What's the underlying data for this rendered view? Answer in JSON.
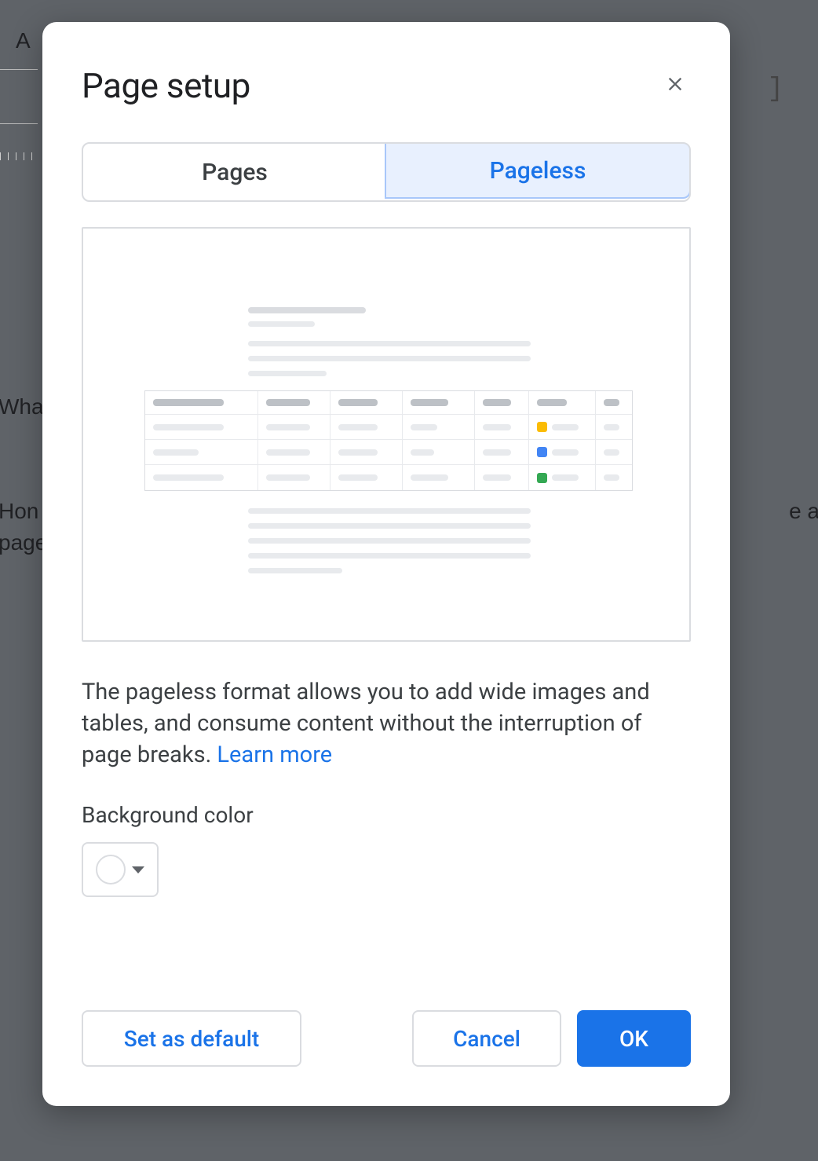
{
  "dialog": {
    "title": "Page setup",
    "tabs": {
      "pages": "Pages",
      "pageless": "Pageless"
    },
    "description_text": "The pageless format allows you to add wide images and tables, and consume content without the interruption of page breaks. ",
    "learn_more": "Learn more",
    "background_color_label": "Background color",
    "buttons": {
      "set_default": "Set as default",
      "cancel": "Cancel",
      "ok": "OK"
    }
  },
  "background": {
    "text1": "A",
    "text2": "Wha",
    "text3": "Hon",
    "text4": "page",
    "text5": "e a"
  }
}
